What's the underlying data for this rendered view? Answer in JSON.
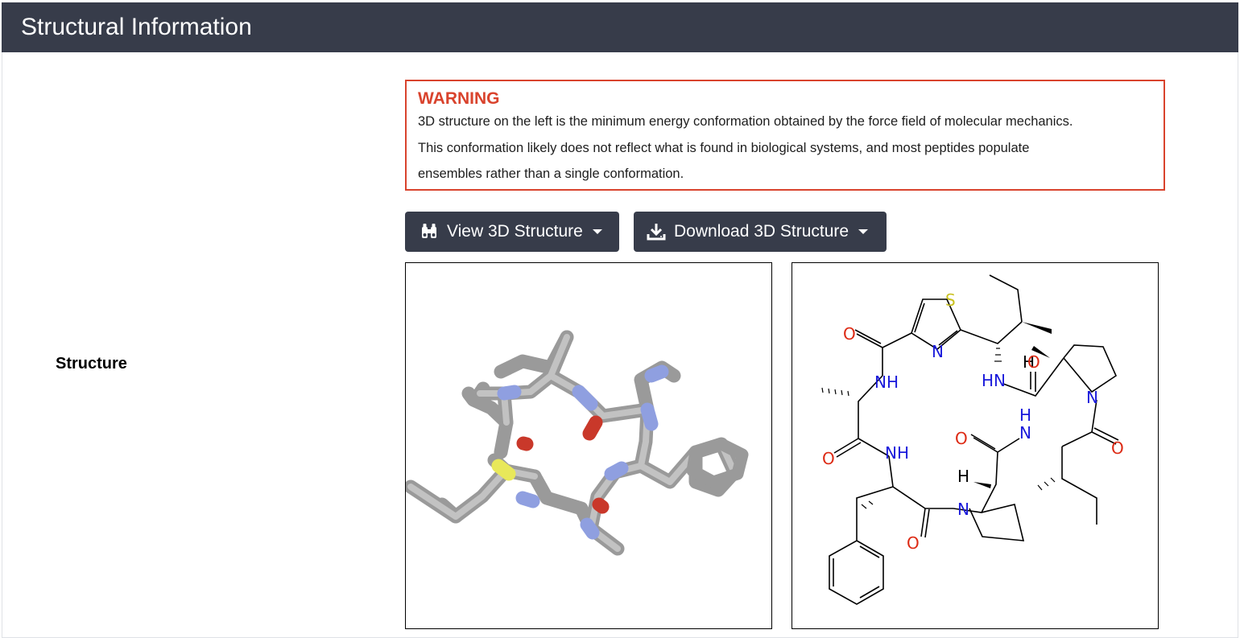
{
  "section": {
    "title": "Structural Information"
  },
  "row": {
    "label": "Structure"
  },
  "warning": {
    "title": "WARNING",
    "lines": [
      "3D structure on the left is the minimum energy conformation obtained by the force field of molecular mechanics.",
      "This conformation likely does not reflect what is found in biological systems, and most peptides populate",
      "ensembles rather than a single conformation."
    ]
  },
  "buttons": {
    "view": {
      "label": "View 3D Structure",
      "icon": "binoculars-icon"
    },
    "download": {
      "label": "Download 3D Structure",
      "icon": "download-icon"
    }
  },
  "structure_labels": {
    "S": "S",
    "N": "N",
    "O": "O",
    "NH": "NH",
    "HN": "HN",
    "H": "H"
  },
  "colors": {
    "header_bg": "#373c4a",
    "warning": "#d9432d",
    "nitrogen": "#1a1adb",
    "oxygen": "#dd2a14",
    "sulfur": "#c9c120",
    "carbon_3d": "#a8a8a8"
  }
}
